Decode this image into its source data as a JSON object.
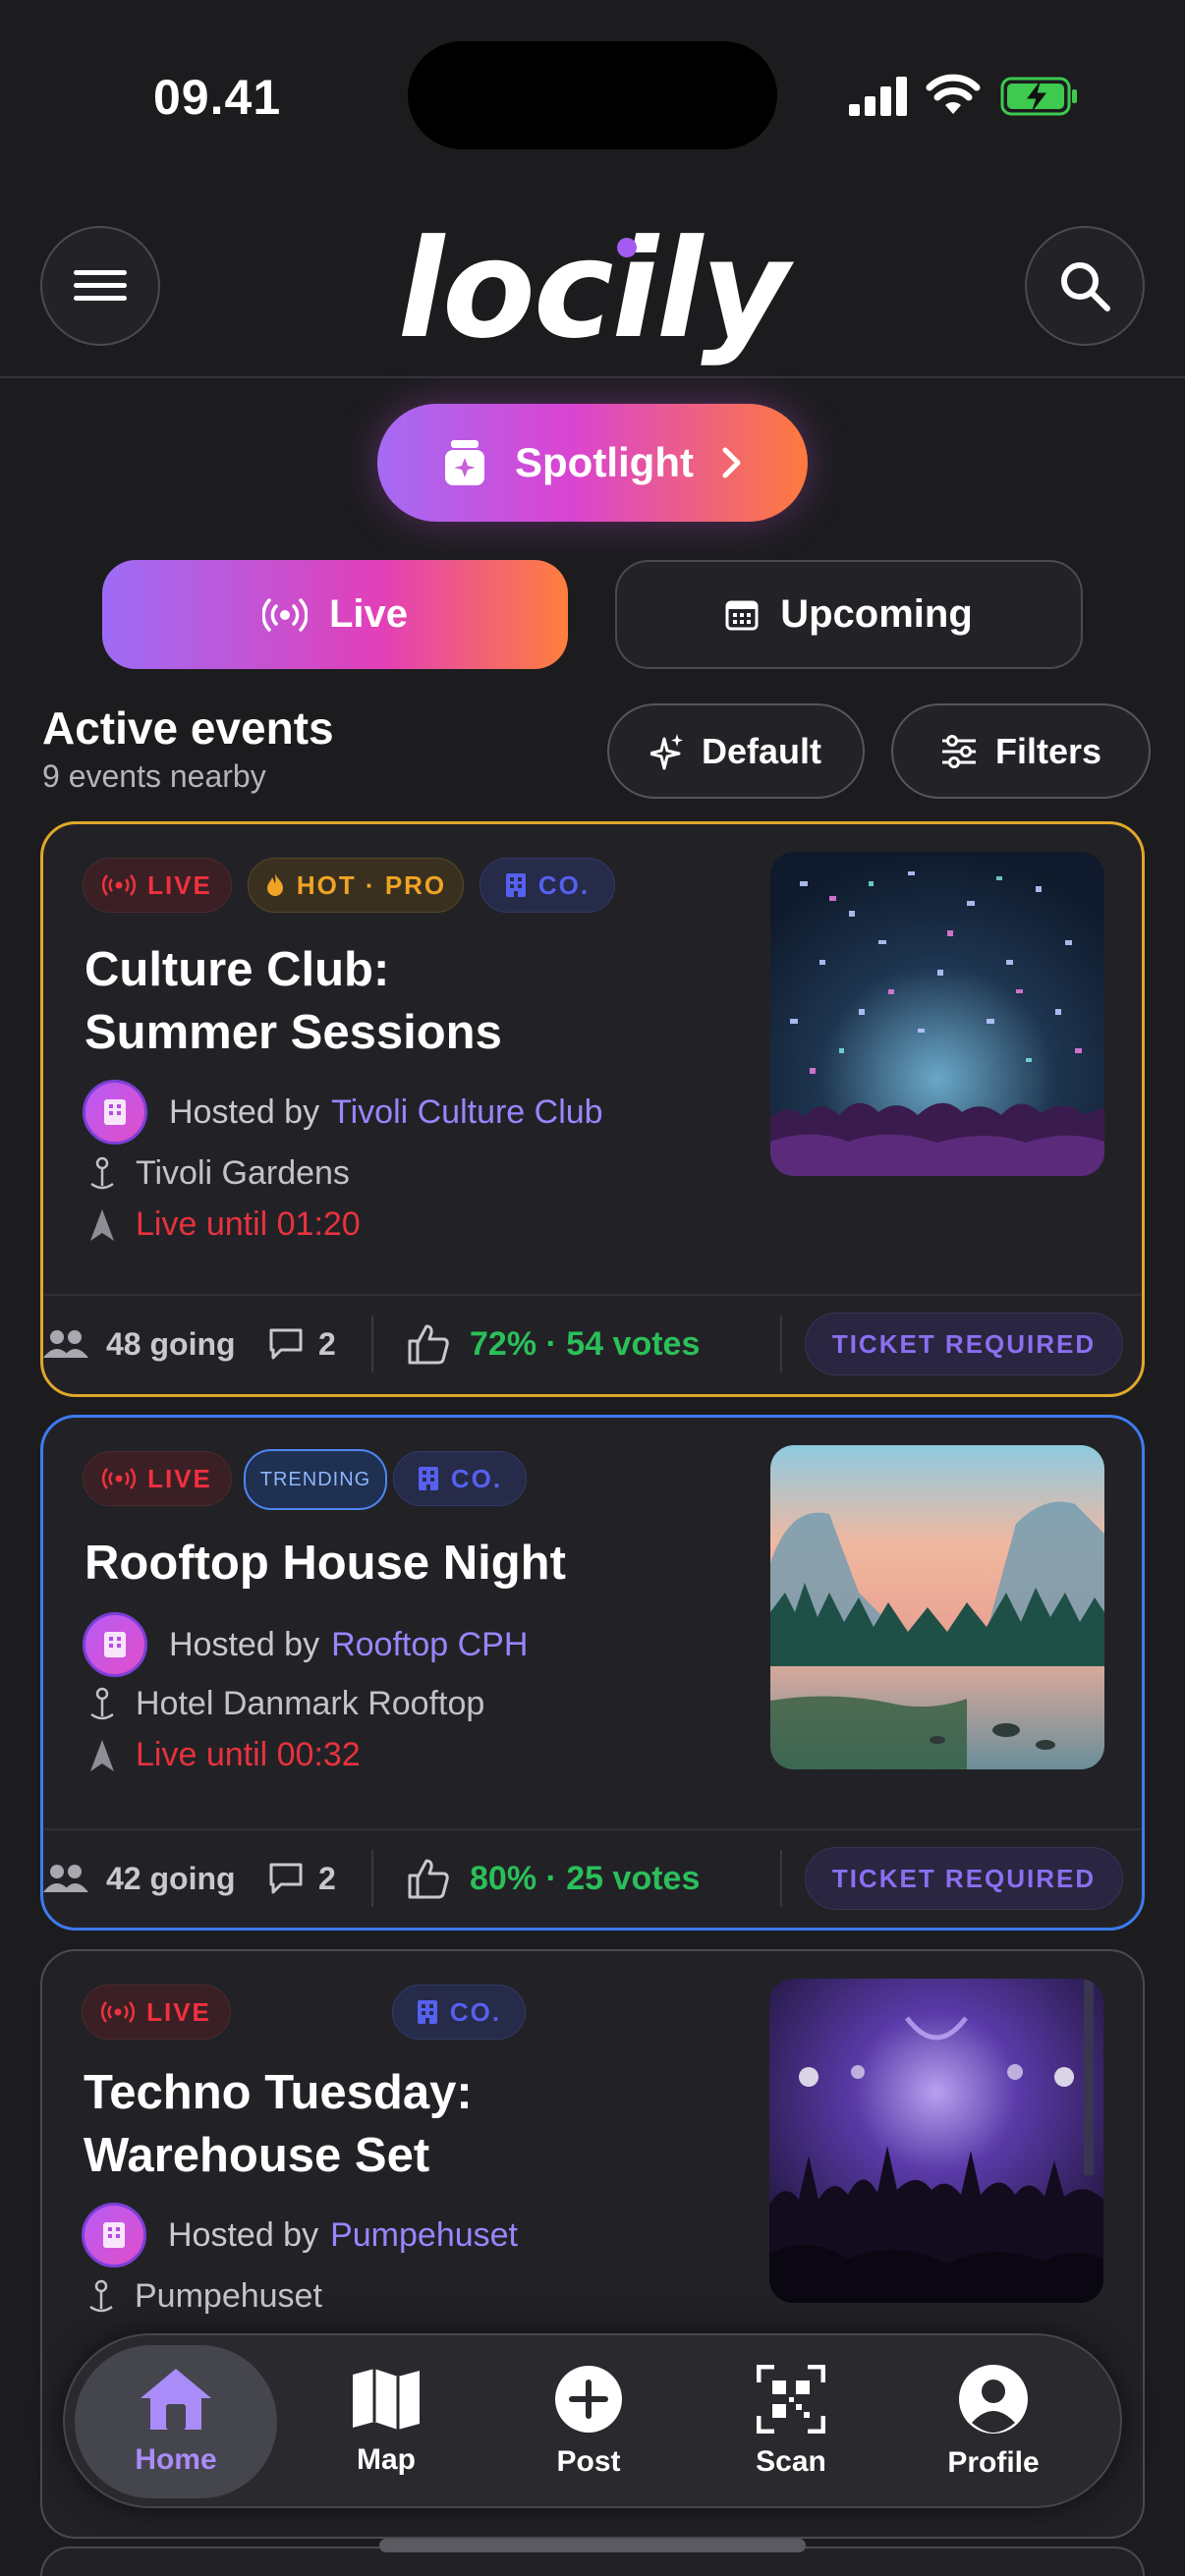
{
  "status_bar": {
    "time": "09.41"
  },
  "header": {
    "logo": "locily"
  },
  "spotlight": {
    "label": "Spotlight"
  },
  "segments": {
    "live": "Live",
    "upcoming": "Upcoming"
  },
  "section": {
    "title": "Active events",
    "subtitle": "9 events nearby",
    "sort_label": "Default",
    "filters_label": "Filters"
  },
  "events": [
    {
      "tags": {
        "live": "LIVE",
        "hot": "HOT · PRO",
        "co": "CO."
      },
      "title_line1": "Culture Club:",
      "title_line2": "Summer Sessions",
      "hosted_by": "Hosted by",
      "host": "Tivoli Culture Club",
      "location": "Tivoli Gardens",
      "live_until": "Live until 01:20",
      "going": "48 going",
      "comments": "2",
      "votes": "72% · 54 votes",
      "ticket": "TICKET REQUIRED"
    },
    {
      "tags": {
        "live": "LIVE",
        "trending": "TRENDING",
        "co": "CO."
      },
      "title_line1": "Rooftop House Night",
      "hosted_by": "Hosted by",
      "host": "Rooftop CPH",
      "location": "Hotel Danmark Rooftop",
      "live_until": "Live until 00:32",
      "going": "42 going",
      "comments": "2",
      "votes": "80% · 25 votes",
      "ticket": "TICKET REQUIRED"
    },
    {
      "tags": {
        "live": "LIVE",
        "co": "CO."
      },
      "title_line1": "Techno Tuesday:",
      "title_line2": "Warehouse Set",
      "hosted_by": "Hosted by",
      "host": "Pumpehuset",
      "location": "Pumpehuset"
    }
  ],
  "nav": {
    "home": "Home",
    "map": "Map",
    "post": "Post",
    "scan": "Scan",
    "profile": "Profile"
  },
  "colors": {
    "accent_purple": "#9c84ff",
    "live_red": "#e8323e",
    "vote_green": "#2bbf5a",
    "card1_border": "#e0a72a",
    "card2_border": "#3d7bf0"
  }
}
